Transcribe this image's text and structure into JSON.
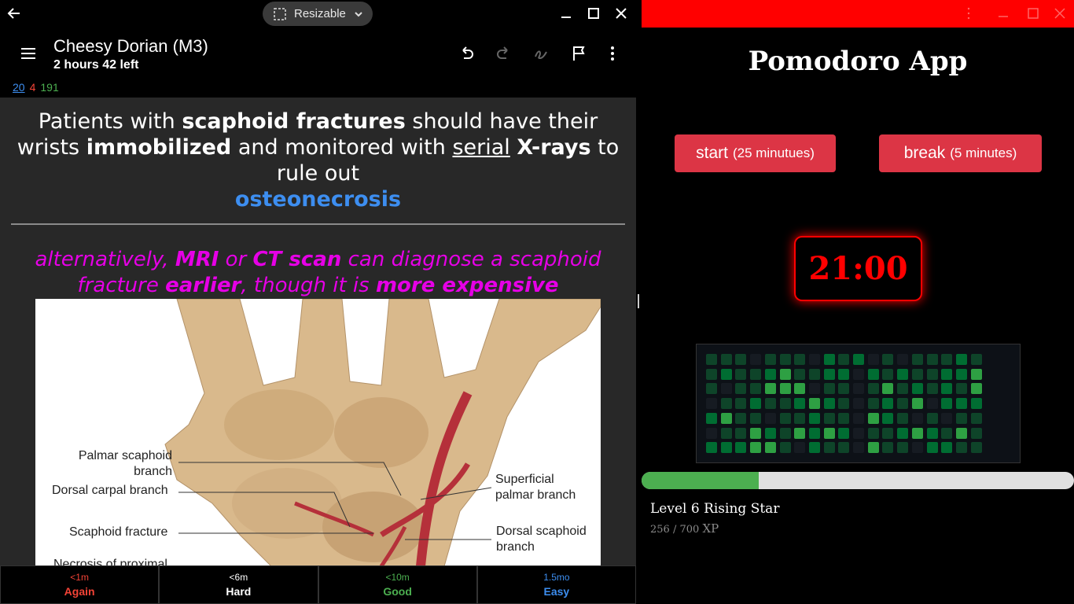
{
  "left_window": {
    "resizable_label": "Resizable",
    "deck_title": "Cheesy Dorian (M3)",
    "deck_subtitle": "2 hours 42 left",
    "counts": {
      "new": "20",
      "learn": "4",
      "review": "191"
    },
    "card_front": {
      "p1": "Patients with ",
      "b1": "scaphoid fractures",
      "p2": " should have their wrists ",
      "b2": "immobilized",
      "p3": " and monitored with ",
      "u1": "serial",
      "p4": " ",
      "b3": "X-rays",
      "p5": " to rule out ",
      "cloze": "osteonecrosis"
    },
    "card_back": {
      "p1": "alternatively, ",
      "b1": "MRI",
      "p2": " or ",
      "b2": "CT scan",
      "p3": " can diagnose a scaphoid fracture ",
      "b3": "earlier",
      "p4": ", though it is ",
      "b4": "more expensive"
    },
    "image_labels": {
      "palmar_scaphoid": "Palmar scaphoid",
      "palmar_scaphoid_2": "branch",
      "dorsal_carpal": "Dorsal carpal branch",
      "scaphoid_fracture": "Scaphoid fracture",
      "necrosis": "Necrosis of proximal",
      "superficial_palmar": "Superficial",
      "superficial_palmar_2": "palmar branch",
      "dorsal_scaphoid": "Dorsal scaphoid",
      "dorsal_scaphoid_2": "branch"
    },
    "answers": [
      {
        "time": "<1m",
        "label": "Again",
        "color": "#f44336"
      },
      {
        "time": "<6m",
        "label": "Hard",
        "color": "#ffffff"
      },
      {
        "time": "<10m",
        "label": "Good",
        "color": "#4caf50"
      },
      {
        "time": "1.5mo",
        "label": "Easy",
        "color": "#3d8ef0"
      }
    ]
  },
  "right_window": {
    "title": "Pomodoro App",
    "start_button": {
      "label": "start",
      "sub": "(25 minutues)"
    },
    "break_button": {
      "label": "break",
      "sub": "(5 minutes)"
    },
    "timer": "21:00",
    "level_text": "Level 6 Rising Star",
    "xp_current": "256",
    "xp_sep": "/",
    "xp_max": "700",
    "xp_unit": "XP",
    "xp_progress": 0.271,
    "heatmap_levels": [
      [
        1,
        1,
        1,
        0,
        1,
        1,
        1,
        0,
        2,
        1,
        2,
        0,
        1,
        0,
        1,
        1,
        1,
        2,
        1
      ],
      [
        1,
        2,
        1,
        1,
        2,
        3,
        1,
        1,
        2,
        2,
        0,
        2,
        1,
        2,
        1,
        1,
        2,
        2,
        3
      ],
      [
        1,
        0,
        1,
        1,
        3,
        3,
        3,
        0,
        1,
        1,
        0,
        1,
        3,
        1,
        2,
        1,
        2,
        1,
        3
      ],
      [
        0,
        1,
        1,
        2,
        1,
        1,
        2,
        3,
        2,
        1,
        0,
        1,
        2,
        1,
        3,
        0,
        2,
        2,
        2
      ],
      [
        2,
        3,
        1,
        1,
        0,
        1,
        1,
        2,
        1,
        1,
        0,
        3,
        2,
        1,
        0,
        1,
        0,
        1,
        1
      ],
      [
        0,
        1,
        1,
        3,
        2,
        1,
        3,
        2,
        3,
        2,
        0,
        1,
        1,
        2,
        3,
        2,
        1,
        3,
        1
      ],
      [
        2,
        2,
        2,
        3,
        3,
        1,
        0,
        2,
        1,
        1,
        0,
        3,
        1,
        1,
        0,
        2,
        2,
        1,
        1
      ]
    ],
    "colors": {
      "accent_red": "#dc3545",
      "timer_red": "#ff0000",
      "xp_green": "#4caf50",
      "topbar_red": "#ff0000"
    }
  }
}
